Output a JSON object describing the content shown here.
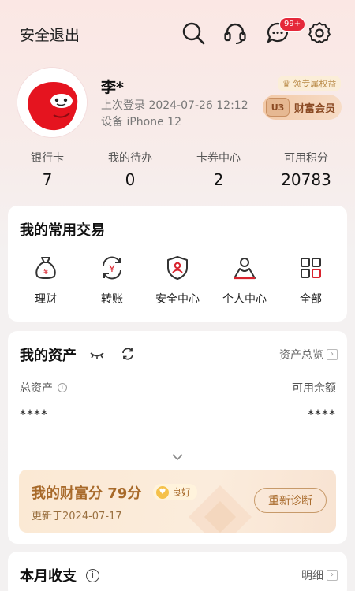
{
  "header": {
    "logout_label": "安全退出",
    "message_badge": "99+"
  },
  "icons": [
    "search-icon",
    "headset-icon",
    "message-icon",
    "settings-icon"
  ],
  "profile": {
    "name": "李*",
    "last_login": "上次登录 2024-07-26 12:12",
    "device": "设备 iPhone 12",
    "perk_label": "领专属权益",
    "member_level": "U3",
    "member_label": "财富会员"
  },
  "stats": [
    {
      "label": "银行卡",
      "value": "7"
    },
    {
      "label": "我的待办",
      "value": "0"
    },
    {
      "label": "卡券中心",
      "value": "2"
    },
    {
      "label": "可用积分",
      "value": "20783"
    }
  ],
  "transactions": {
    "title": "我的常用交易",
    "items": [
      {
        "label": "理财",
        "icon": "moneybag-icon"
      },
      {
        "label": "转账",
        "icon": "transfer-icon"
      },
      {
        "label": "安全中心",
        "icon": "shield-icon"
      },
      {
        "label": "个人中心",
        "icon": "person-icon"
      },
      {
        "label": "全部",
        "icon": "grid-icon"
      }
    ]
  },
  "assets": {
    "title": "我的资产",
    "overview_label": "资产总览",
    "total_label": "总资产",
    "available_label": "可用余额",
    "total_value": "****",
    "available_value": "****",
    "wealth_score_title": "我的财富分 79分",
    "wealth_grade": "良好",
    "updated": "更新于2024-07-17",
    "rediagnose_label": "重新诊断"
  },
  "monthly": {
    "title": "本月收支",
    "detail_label": "明细"
  },
  "colors": {
    "brand_red": "#d9232e",
    "gold": "#a86a2a"
  }
}
